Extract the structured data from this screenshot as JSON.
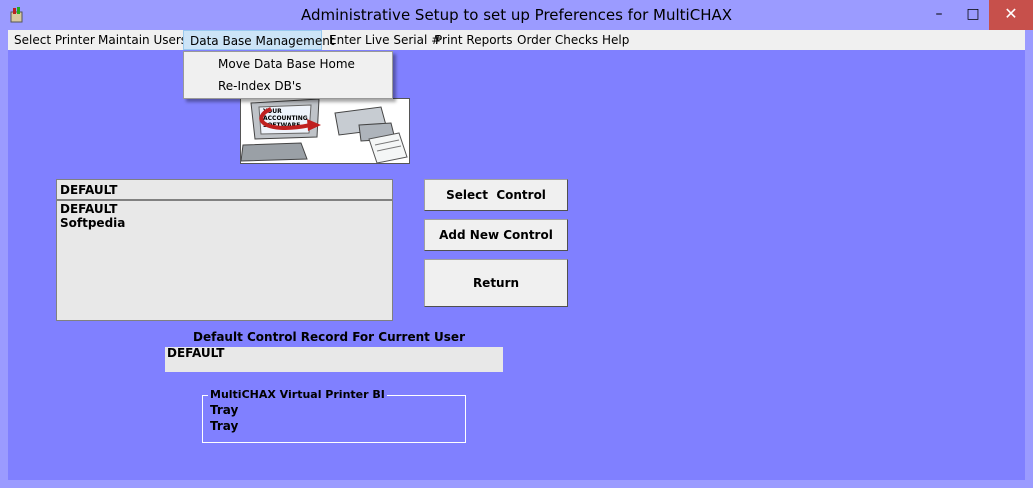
{
  "window": {
    "title": "Administrative Setup to set up Preferences for MultiCHAX",
    "minimize": "–",
    "maximize": "□",
    "close": "✕"
  },
  "menu": {
    "items": [
      "Select Printer",
      "Maintain Users",
      "Data Base Management",
      "Enter Live Serial #",
      "Print Reports",
      "Order Checks",
      "Help"
    ],
    "open_menu": "Data Base Management",
    "dropdown": [
      "Move Data Base Home",
      "Re-Index DB's"
    ]
  },
  "picture": {
    "screen_text": [
      "YOUR",
      "ACCOUNTING",
      "SOFTWARE"
    ]
  },
  "control_list": {
    "selected": "DEFAULT",
    "items": [
      "DEFAULT",
      "Softpedia"
    ]
  },
  "buttons": {
    "select": "Select  Control",
    "add": "Add New Control",
    "return": "Return"
  },
  "default_record": {
    "label": "Default Control Record For Current User",
    "value": "DEFAULT"
  },
  "printer_group": {
    "title": "MultiCHAX Virtual Printer BI",
    "lines": [
      "Tray",
      "Tray"
    ]
  },
  "colors": {
    "background": "#8080ff",
    "title_bar": "#9b9bff",
    "close_button": "#c7504b",
    "menu_highlight": "#cce4f7"
  }
}
